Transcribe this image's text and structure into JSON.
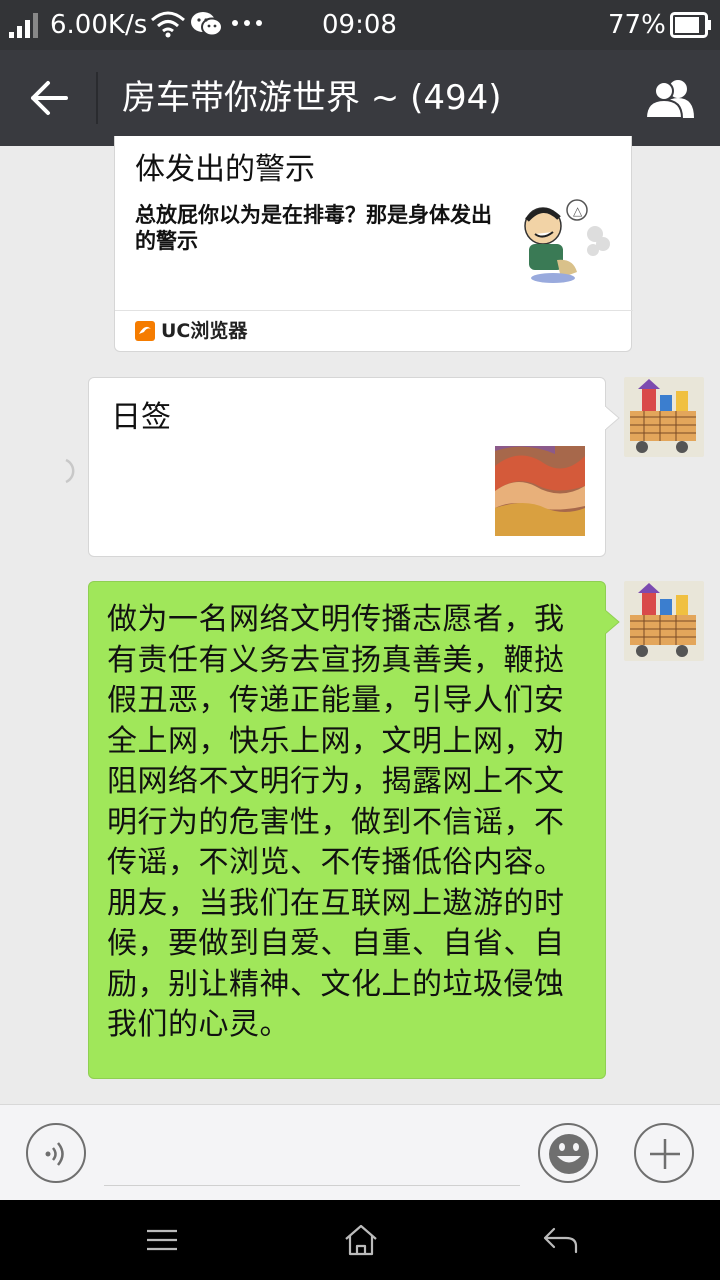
{
  "status_bar": {
    "speed": "6.00K/s",
    "time": "09:08",
    "battery": "77%",
    "icons": [
      "signal-icon",
      "wifi-icon",
      "wechat-icon",
      "more-dots-icon",
      "battery-icon"
    ]
  },
  "title_bar": {
    "title": "房车带你游世界 ~ (494)",
    "back_icon": "back-arrow-icon",
    "group_icon": "group-members-icon"
  },
  "messages": [
    {
      "type": "link_card",
      "title_partial": "体发出的警示",
      "description": "总放屁你以为是在排毒？那是身体发出的警示",
      "source": "UC浏览器"
    },
    {
      "type": "link_card_outgoing",
      "title": "日签",
      "status": "sending"
    },
    {
      "type": "text_outgoing",
      "text": "做为一名网络文明传播志愿者，我有责任有义务去宣扬真善美，鞭挞假丑恶，传递正能量，引导人们安全上网，快乐上网，文明上网，劝阻网络不文明行为，揭露网上不文明行为的危害性，做到不信谣，不传谣，不浏览、不传播低俗内容。朋友，当我们在互联网上遨游的时候，要做到自爱、自重、自省、自励，别让精神、文化上的垃圾侵蚀我们的心灵。"
    }
  ],
  "colors": {
    "status_bar_bg": "#333437",
    "title_bar_bg": "#393a3f",
    "chat_bg": "#ebebeb",
    "outgoing_bubble": "#a0e75a",
    "nav_bar_bg": "#000000"
  }
}
